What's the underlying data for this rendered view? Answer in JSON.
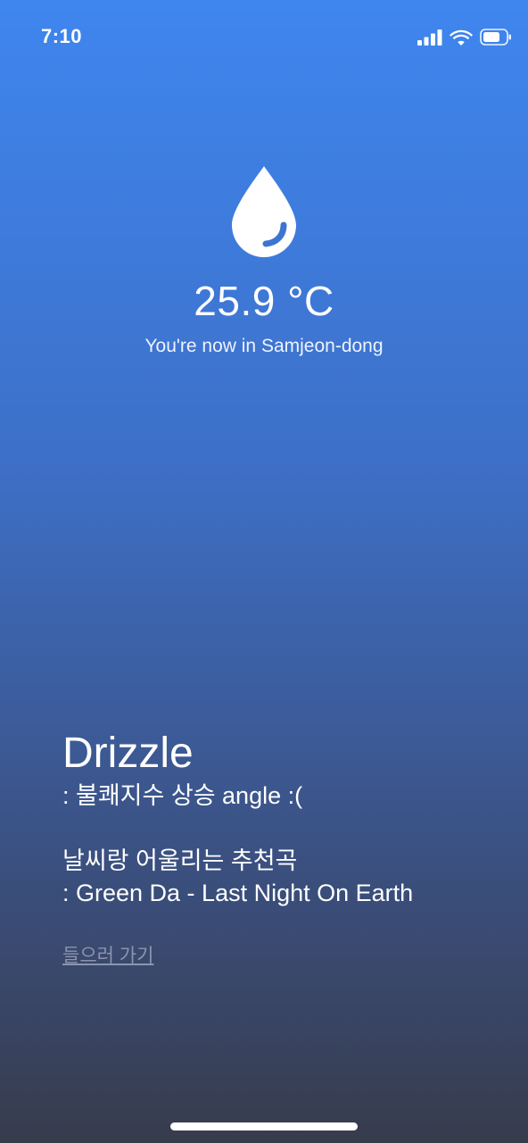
{
  "status_bar": {
    "time": "7:10",
    "signal_icon": "cellular-signal-icon",
    "wifi_icon": "wifi-icon",
    "battery_icon": "battery-icon"
  },
  "weather": {
    "icon": "raindrop-icon",
    "temperature": "25.9 °C",
    "location_text": "You're now in Samjeon-dong",
    "condition": "Drizzle",
    "condition_desc": " : 불쾌지수 상승 angle :("
  },
  "recommendation": {
    "title": "날씨랑 어울리는 추천곡",
    "song": " : Green Da - Last Night On Earth",
    "listen_link": "들으러 가기"
  },
  "colors": {
    "gradient_top": "#3f86ef",
    "gradient_bottom": "#373c4c",
    "text": "#ffffff",
    "link": "#8b95ad"
  }
}
